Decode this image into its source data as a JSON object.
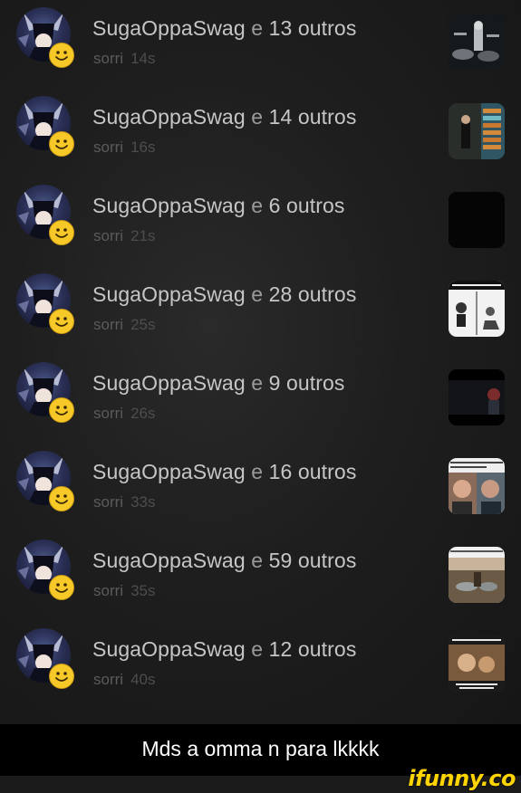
{
  "notifications": [
    {
      "user": "SugaOppaSwag",
      "conj": "e",
      "others": "13 outros",
      "action": "sorri",
      "time": "14s",
      "thumb": "drummer"
    },
    {
      "user": "SugaOppaSwag",
      "conj": "e",
      "others": "14 outros",
      "action": "sorri",
      "time": "16s",
      "thumb": "band-poster"
    },
    {
      "user": "SugaOppaSwag",
      "conj": "e",
      "others": "6 outros",
      "action": "sorri",
      "time": "21s",
      "thumb": "black"
    },
    {
      "user": "SugaOppaSwag",
      "conj": "e",
      "others": "28 outros",
      "action": "sorri",
      "time": "25s",
      "thumb": "comic-acdc"
    },
    {
      "user": "SugaOppaSwag",
      "conj": "e",
      "others": "9 outros",
      "action": "sorri",
      "time": "26s",
      "thumb": "dark-video"
    },
    {
      "user": "SugaOppaSwag",
      "conj": "e",
      "others": "16 outros",
      "action": "sorri",
      "time": "33s",
      "thumb": "two-faces"
    },
    {
      "user": "SugaOppaSwag",
      "conj": "e",
      "others": "59 outros",
      "action": "sorri",
      "time": "35s",
      "thumb": "stage-photo"
    },
    {
      "user": "SugaOppaSwag",
      "conj": "e",
      "others": "12 outros",
      "action": "sorri",
      "time": "40s",
      "thumb": "meme-caption"
    }
  ],
  "caption": "Mds a omma n para lkkkk",
  "watermark": "ifunny.co",
  "colors": {
    "background": "#1e1e1e",
    "username": "#c6c6c6",
    "subtext": "#5b5b5b",
    "smiley": "#f7c928",
    "watermark": "#ffd400"
  }
}
